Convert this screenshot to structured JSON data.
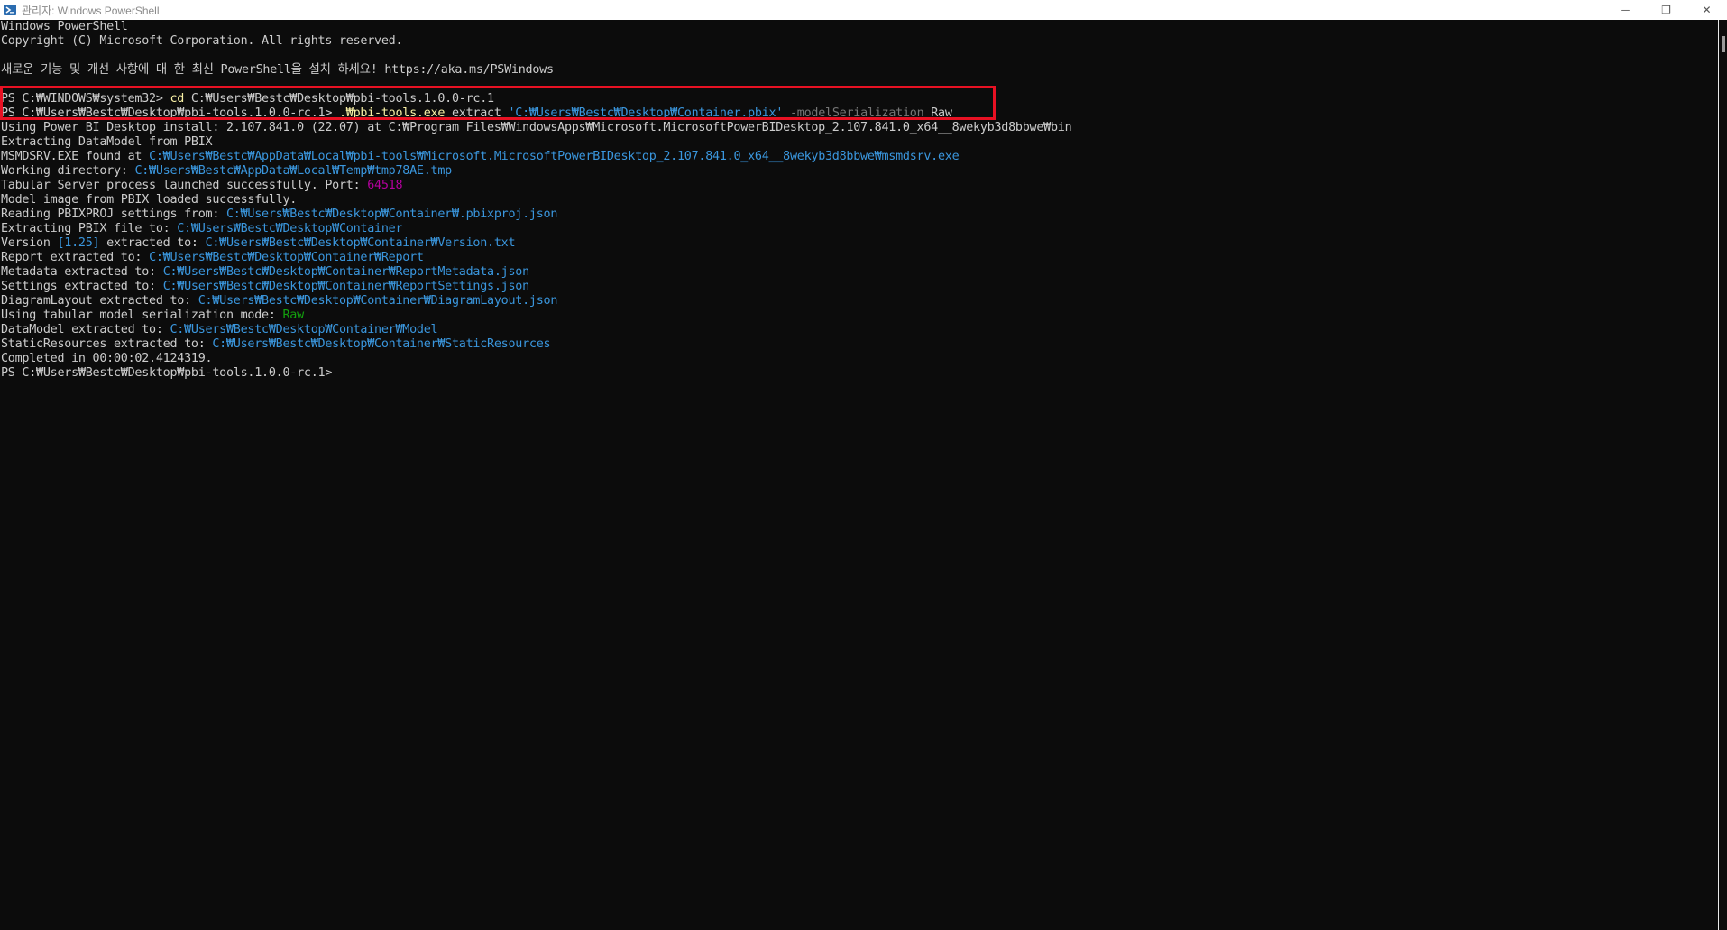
{
  "window": {
    "title": "관리자: Windows PowerShell",
    "icon": "powershell-icon",
    "controls": {
      "minimize": "─",
      "restore": "❐",
      "close": "✕"
    }
  },
  "console": {
    "lines": [
      [
        {
          "t": "Windows PowerShell",
          "c": "def"
        }
      ],
      [
        {
          "t": "Copyright (C) Microsoft Corporation. All rights reserved.",
          "c": "def"
        }
      ],
      [
        {
          "t": "",
          "c": "def"
        }
      ],
      [
        {
          "t": "새로운 기능 및 개선 사항에 대 한 최신 PowerShell을 설치 하세요! https://aka.ms/PSWindows",
          "c": "def"
        }
      ],
      [
        {
          "t": "",
          "c": "def"
        }
      ],
      [
        {
          "t": "PS C:₩WINDOWS₩system32> ",
          "c": "def"
        },
        {
          "t": "cd",
          "c": "cmd"
        },
        {
          "t": " C:₩Users₩Bestc₩Desktop₩pbi-tools.1.0.0-rc.1",
          "c": "def"
        }
      ],
      [
        {
          "t": "PS C:₩Users₩Bestc₩Desktop₩pbi-tools.1.0.0-rc.1> ",
          "c": "def"
        },
        {
          "t": ".₩pbi-tools.exe",
          "c": "cmd"
        },
        {
          "t": " extract ",
          "c": "def"
        },
        {
          "t": "'C:₩Users₩Bestc₩Desktop₩Container.pbix'",
          "c": "str"
        },
        {
          "t": " -modelSerialization",
          "c": "param"
        },
        {
          "t": " Raw",
          "c": "def"
        }
      ],
      [
        {
          "t": "Using Power BI Desktop install: 2.107.841.0 (22.07) at C:₩Program Files₩WindowsApps₩Microsoft.MicrosoftPowerBIDesktop_2.107.841.0_x64__8wekyb3d8bbwe₩bin",
          "c": "def"
        }
      ],
      [
        {
          "t": "Extracting DataModel from PBIX",
          "c": "def"
        }
      ],
      [
        {
          "t": "MSMDSRV.EXE found at ",
          "c": "def"
        },
        {
          "t": "C:₩Users₩Bestc₩AppData₩Local₩pbi-tools₩Microsoft.MicrosoftPowerBIDesktop_2.107.841.0_x64__8wekyb3d8bbwe₩msmdsrv.exe",
          "c": "path"
        }
      ],
      [
        {
          "t": "Working directory: ",
          "c": "def"
        },
        {
          "t": "C:₩Users₩Bestc₩AppData₩Local₩Temp₩tmp78AE.tmp",
          "c": "path"
        }
      ],
      [
        {
          "t": "Tabular Server process launched successfully. Port: ",
          "c": "def"
        },
        {
          "t": "64518",
          "c": "num"
        }
      ],
      [
        {
          "t": "Model image from PBIX loaded successfully.",
          "c": "def"
        }
      ],
      [
        {
          "t": "Reading PBIXPROJ settings from: ",
          "c": "def"
        },
        {
          "t": "C:₩Users₩Bestc₩Desktop₩Container₩.pbixproj.json",
          "c": "path"
        }
      ],
      [
        {
          "t": "Extracting PBIX file to: ",
          "c": "def"
        },
        {
          "t": "C:₩Users₩Bestc₩Desktop₩Container",
          "c": "path"
        }
      ],
      [
        {
          "t": "Version ",
          "c": "def"
        },
        {
          "t": "[1.25]",
          "c": "path"
        },
        {
          "t": " extracted to: ",
          "c": "def"
        },
        {
          "t": "C:₩Users₩Bestc₩Desktop₩Container₩Version.txt",
          "c": "path"
        }
      ],
      [
        {
          "t": "Report extracted to: ",
          "c": "def"
        },
        {
          "t": "C:₩Users₩Bestc₩Desktop₩Container₩Report",
          "c": "path"
        }
      ],
      [
        {
          "t": "Metadata extracted to: ",
          "c": "def"
        },
        {
          "t": "C:₩Users₩Bestc₩Desktop₩Container₩ReportMetadata.json",
          "c": "path"
        }
      ],
      [
        {
          "t": "Settings extracted to: ",
          "c": "def"
        },
        {
          "t": "C:₩Users₩Bestc₩Desktop₩Container₩ReportSettings.json",
          "c": "path"
        }
      ],
      [
        {
          "t": "DiagramLayout extracted to: ",
          "c": "def"
        },
        {
          "t": "C:₩Users₩Bestc₩Desktop₩Container₩DiagramLayout.json",
          "c": "path"
        }
      ],
      [
        {
          "t": "Using tabular model serialization mode: ",
          "c": "def"
        },
        {
          "t": "Raw",
          "c": "grn"
        }
      ],
      [
        {
          "t": "DataModel extracted to: ",
          "c": "def"
        },
        {
          "t": "C:₩Users₩Bestc₩Desktop₩Container₩Model",
          "c": "path"
        }
      ],
      [
        {
          "t": "StaticResources extracted to: ",
          "c": "def"
        },
        {
          "t": "C:₩Users₩Bestc₩Desktop₩Container₩StaticResources",
          "c": "path"
        }
      ],
      [
        {
          "t": "Completed in 00:00:02.4124319.",
          "c": "def"
        }
      ],
      [
        {
          "t": "PS C:₩Users₩Bestc₩Desktop₩pbi-tools.1.0.0-rc.1> ",
          "c": "def"
        }
      ]
    ]
  },
  "colors": {
    "background": "#0c0c0c",
    "foreground": "#cccccc",
    "highlight_border": "#e81123"
  }
}
